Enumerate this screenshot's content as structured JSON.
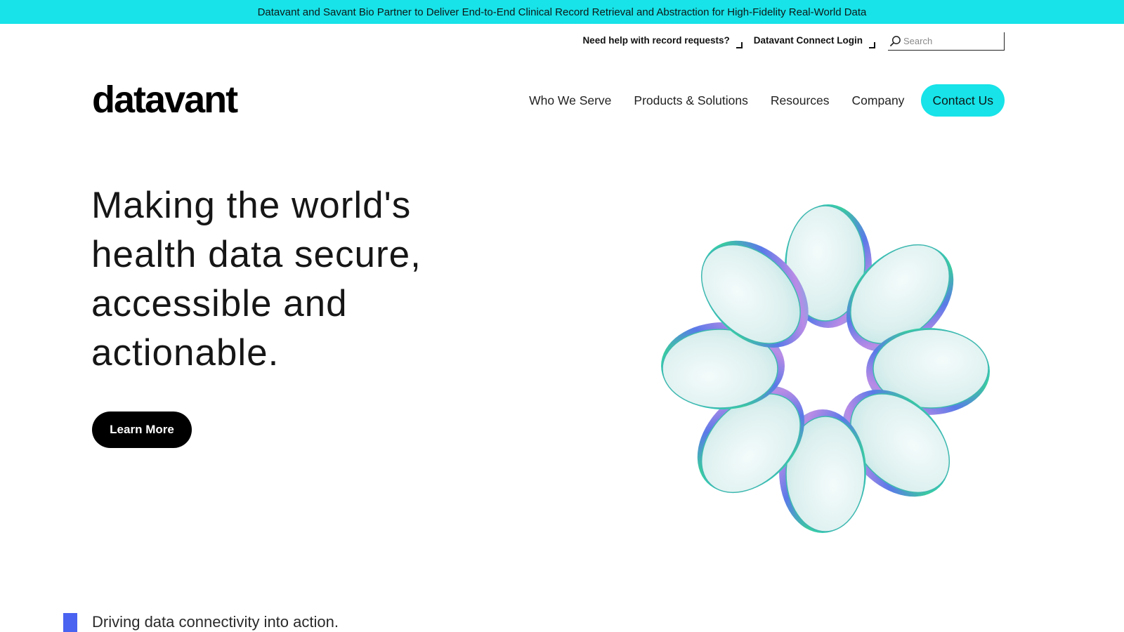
{
  "announcement": {
    "text": "Datavant and Savant Bio Partner to Deliver End-to-End Clinical Record Retrieval and Abstraction for High-Fidelity Real-World Data"
  },
  "utility_nav": {
    "record_help": "Need help with record requests?",
    "connect_login": "Datavant Connect Login",
    "search_placeholder": "Search"
  },
  "logo": {
    "text": "datavant"
  },
  "main_nav": {
    "items": [
      "Who We Serve",
      "Products & Solutions",
      "Resources",
      "Company"
    ],
    "cta": "Contact Us"
  },
  "hero": {
    "headline": [
      "Making the world's",
      "health data secure,",
      "accessible and",
      "actionable."
    ],
    "button": "Learn More"
  },
  "tagline": {
    "text": "Driving data connectivity into action."
  },
  "colors": {
    "accent_cyan": "#17e3e8",
    "button_black": "#000000",
    "tagline_bar_blue": "#4a63f0",
    "text_dark": "#161616"
  },
  "icons": {
    "search": "search-icon",
    "external_link": "corner-arrow-icon"
  }
}
